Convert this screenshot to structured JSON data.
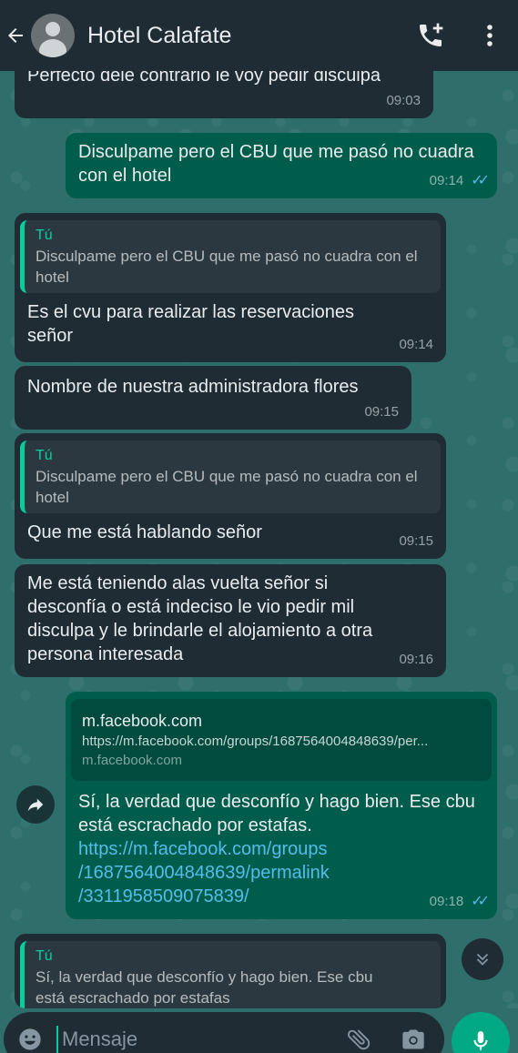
{
  "header": {
    "title": "Hotel Calafate"
  },
  "messages": [
    {
      "text": "Perfecto dele contrario le voy pedir disculpa",
      "time": "09:03"
    },
    {
      "text": "Disculpame pero el CBU que me pasó no cuadra con el hotel",
      "time": "09:14"
    },
    {
      "quote_author": "Tú",
      "quote_text": "Disculpame pero el CBU que me pasó no cuadra con el hotel",
      "text": "Es el cvu para realizar las reservaciones señor",
      "time": "09:14"
    },
    {
      "text": "Nombre de nuestra administradora flores",
      "time": "09:15"
    },
    {
      "quote_author": "Tú",
      "quote_text": "Disculpame pero el CBU que me pasó no cuadra con el hotel",
      "text": "Que me está hablando señor",
      "time": "09:15"
    },
    {
      "text": "Me está teniendo alas vuelta señor si desconfía o está indeciso le vio pedir mil disculpa y le brindarle el alojamiento a otra persona interesada",
      "time": "09:16"
    },
    {
      "preview_title": "m.facebook.com",
      "preview_url": "https://m.facebook.com/groups/1687564004848639/per...",
      "preview_domain": "m.facebook.com",
      "text": "Sí, la verdad que desconfío y hago bien. Ese cbu está escrachado por estafas.",
      "link_1": "https://m.facebook.com/groups",
      "link_2": "/1687564004848639/permalink",
      "link_3": "/3311958509075839/",
      "time": "09:18"
    },
    {
      "quote_author": "Tú",
      "quote_text": "Sí, la verdad que desconfío y hago bien. Ese cbu",
      "quote_text_2": "está escrachado por estafas"
    }
  ],
  "input": {
    "placeholder": "Mensaje"
  },
  "colors": {
    "header": "#1f2c34",
    "incoming": "#1f2c34",
    "outgoing": "#005c4b",
    "accent": "#00a884",
    "read_ticks": "#53bdeb"
  }
}
